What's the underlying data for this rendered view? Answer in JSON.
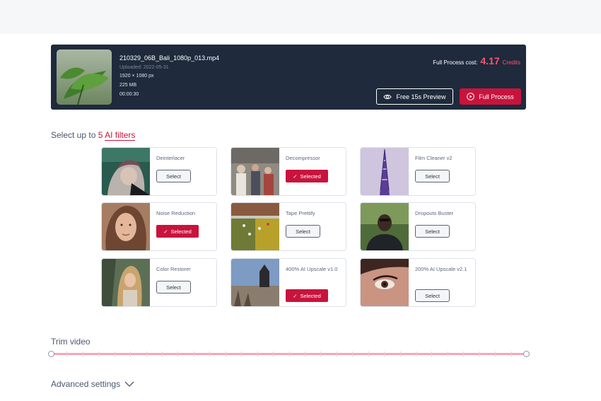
{
  "file": {
    "name": "210329_06B_Bali_1080p_013.mp4",
    "uploaded": "Uploaded: 2022-05-31",
    "resolution": "1920 × 1080 px",
    "size": "225 MB",
    "duration": "00:00:30"
  },
  "cost": {
    "label": "Full Process cost:",
    "value": "4.17",
    "unit": "Credits"
  },
  "actions": {
    "preview_label": "Free 15s Preview",
    "full_label": "Full Process"
  },
  "filters_header": {
    "prefix": "Select up to",
    "count": "5",
    "link": "AI filters"
  },
  "filters": [
    {
      "name": "Deinterlacer",
      "state": "Select"
    },
    {
      "name": "Decompressor",
      "state": "Selected"
    },
    {
      "name": "Film Cleaner v2",
      "state": "Select"
    },
    {
      "name": "Noise Reduction",
      "state": "Selected"
    },
    {
      "name": "Tape Prettify",
      "state": "Select"
    },
    {
      "name": "Dropouts Buster",
      "state": "Select"
    },
    {
      "name": "Color Restorer",
      "state": "Select"
    },
    {
      "name": "400% AI Upscale v1.0",
      "state": "Selected"
    },
    {
      "name": "200% AI Upscale v2.1",
      "state": "Select"
    }
  ],
  "trim": {
    "title": "Trim video"
  },
  "advanced": {
    "label": "Advanced settings"
  },
  "colors": {
    "accent": "#c8143d",
    "dark_card": "#1f2a3c",
    "cost_value": "#ff5470"
  }
}
